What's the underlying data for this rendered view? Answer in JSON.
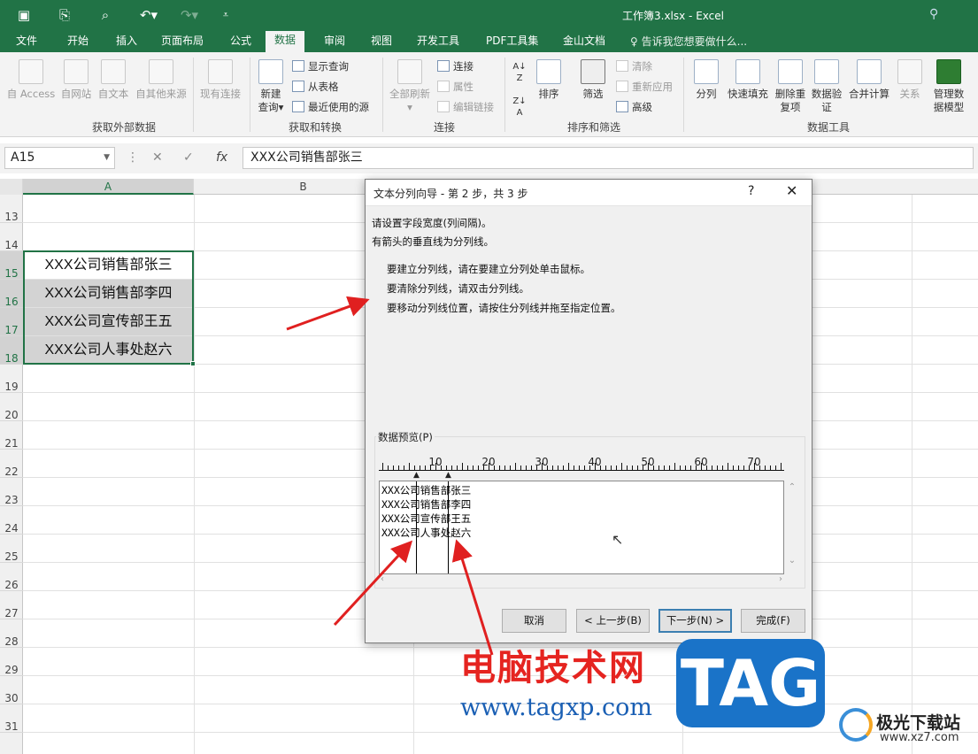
{
  "window": {
    "title": "工作簿3.xlsx - Excel"
  },
  "ribbon_tabs": [
    "文件",
    "开始",
    "插入",
    "页面布局",
    "公式",
    "数据",
    "审阅",
    "视图",
    "开发工具",
    "PDF工具集",
    "金山文档"
  ],
  "active_tab": "数据",
  "tell_me": "告诉我您想要做什么...",
  "ribbon": {
    "groups": [
      "获取外部数据",
      "获取和转换",
      "连接",
      "排序和筛选",
      "数据工具"
    ],
    "external": [
      "自 Access",
      "自网站",
      "自文本",
      "自其他来源",
      "现有连接"
    ],
    "new_query": [
      "新建",
      "查询"
    ],
    "transform": [
      "显示查询",
      "从表格",
      "最近使用的源"
    ],
    "refresh_all": "全部刷新",
    "connections": [
      "连接",
      "属性",
      "编辑链接"
    ],
    "sort_az": "A↓Z",
    "sort_label": "排序",
    "filter_label": "筛选",
    "filter_opts": [
      "清除",
      "重新应用",
      "高级"
    ],
    "tools": [
      "分列",
      "快速填充",
      "删除重复项",
      "数据验证",
      "合并计算",
      "关系",
      "管理数据模型"
    ]
  },
  "formula_bar": {
    "name_box": "A15",
    "fx": "fx",
    "content": "XXX公司销售部张三"
  },
  "sheet": {
    "columns": [
      "A",
      "B"
    ],
    "rows": [
      "13",
      "14",
      "15",
      "16",
      "17",
      "18",
      "19",
      "20",
      "21",
      "22",
      "23",
      "24",
      "25",
      "26",
      "27",
      "28",
      "29",
      "30",
      "31"
    ],
    "cells": [
      "XXX公司销售部张三",
      "XXX公司销售部李四",
      "XXX公司宣传部王五",
      "XXX公司人事处赵六"
    ]
  },
  "dialog": {
    "title": "文本分列向导 - 第 2 步，共 3 步",
    "help": "?",
    "close": "✕",
    "intro1": "请设置字段宽度(列间隔)。",
    "intro2": "有箭头的垂直线为分列线。",
    "instr1": "要建立分列线，请在要建立分列处单击鼠标。",
    "instr2": "要清除分列线，请双击分列线。",
    "instr3": "要移动分列线位置，请按住分列线并拖至指定位置。",
    "preview_label": "数据预览(P)",
    "ruler": [
      "10",
      "20",
      "30",
      "40",
      "50",
      "60",
      "70"
    ],
    "preview_lines": [
      "XXX公司销售部张三",
      "XXX公司销售部李四",
      "XXX公司宣传部王五",
      "XXX公司人事处赵六"
    ],
    "buttons": {
      "cancel": "取消",
      "back": "< 上一步(B)",
      "next": "下一步(N) >",
      "finish": "完成(F)"
    }
  },
  "watermark": {
    "cn": "电脑技术网",
    "url": "www.tagxp.com",
    "logo": "TAG",
    "site": "极光下载站",
    "site_url": "www.xz7.com"
  },
  "colors": {
    "excel_green": "#217346",
    "arrow_red": "#e02020",
    "tag_blue": "#1a73c8"
  }
}
